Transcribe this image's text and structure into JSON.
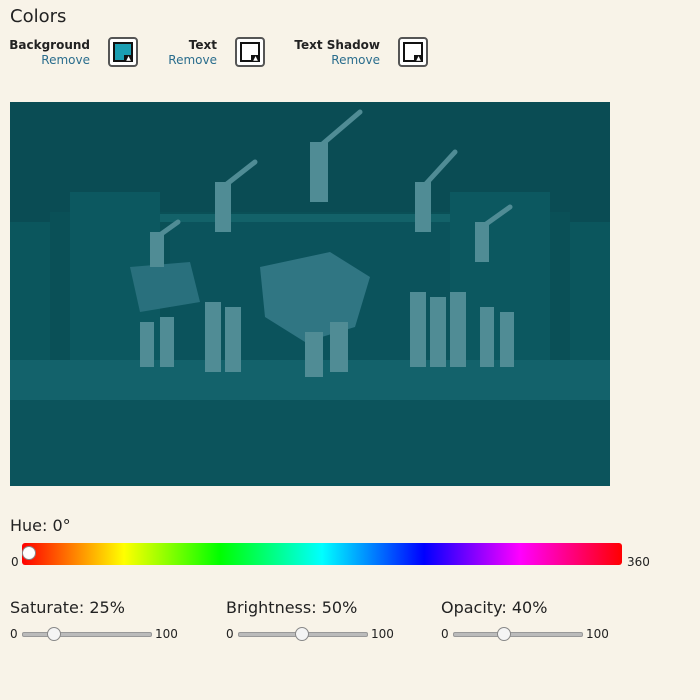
{
  "section_title": "Colors",
  "color_pickers": [
    {
      "name": "Background",
      "remove": "Remove",
      "color": "#1a9eb2"
    },
    {
      "name": "Text",
      "remove": "Remove",
      "color": "#ffffff"
    },
    {
      "name": "Text Shadow",
      "remove": "Remove",
      "color": "#ffffff"
    }
  ],
  "preview": {
    "tint_color": "#0b4f57",
    "tint_opacity": 0.4,
    "description_icon": "cheerleaders-stage-image"
  },
  "hue": {
    "label": "Hue: 0°",
    "min": "0",
    "max": "360",
    "value": 0
  },
  "sliders": [
    {
      "label": "Saturate: 25%",
      "min": "0",
      "max": "100",
      "value": 25
    },
    {
      "label": "Brightness: 50%",
      "min": "0",
      "max": "100",
      "value": 50
    },
    {
      "label": "Opacity: 40%",
      "min": "0",
      "max": "100",
      "value": 40
    }
  ]
}
